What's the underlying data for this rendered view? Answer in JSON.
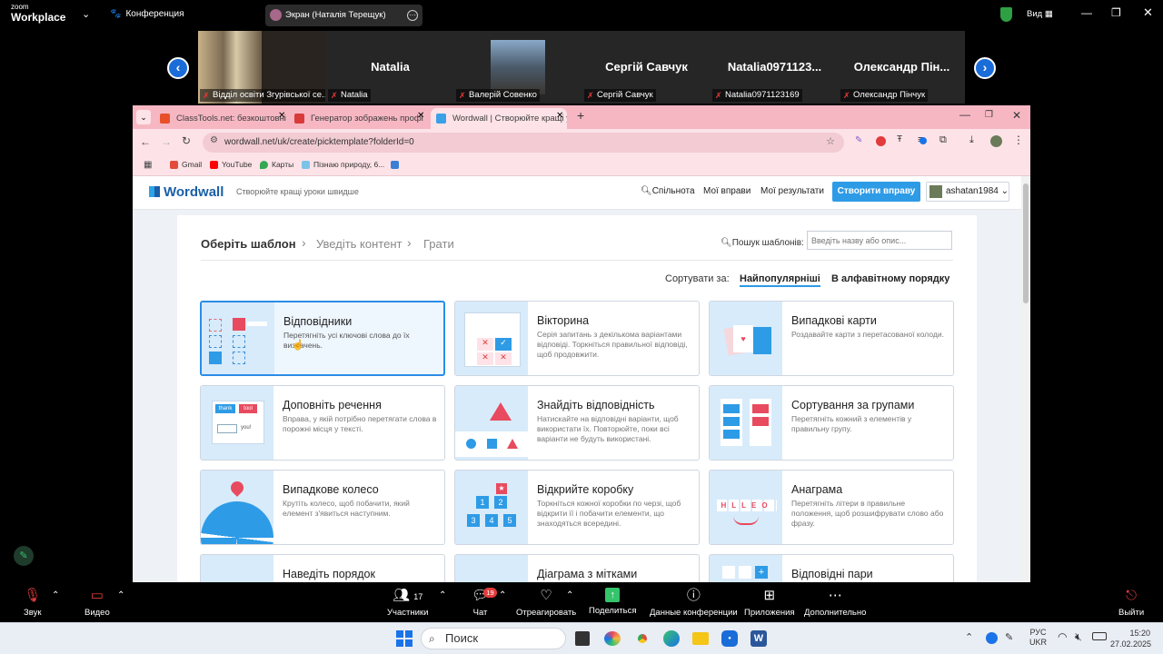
{
  "zoom": {
    "brand_top": "zoom",
    "brand_bottom": "Workplace",
    "meeting_title": "Конференция",
    "share_label": "Экран (Наталія Терещук)",
    "view_label": "Вид"
  },
  "participants": [
    {
      "name": "",
      "label": "Відділ освіти Згурівської се..."
    },
    {
      "name": "Natalia",
      "label": "Natalia"
    },
    {
      "name": "",
      "label": "Валерій Совенко"
    },
    {
      "name": "Сергій Савчук",
      "label": "Сергій Савчук"
    },
    {
      "name": "Natalia0971123...",
      "label": "Natalia0971123169"
    },
    {
      "name": "Олександр Пін...",
      "label": "Олександр Пінчук"
    }
  ],
  "browser": {
    "tabs": [
      {
        "title": "ClassTools.net: безкоштовні ін...",
        "color": "#e8502a"
      },
      {
        "title": "Генератор зображень профіл...",
        "color": "#d93a3a"
      },
      {
        "title": "Wordwall | Створюйте кращі у...",
        "color": "#3aa0e8"
      }
    ],
    "url": "wordwall.net/uk/create/picktemplate?folderId=0",
    "bookmarks": [
      {
        "label": "Gmail",
        "color": "#e24b3b"
      },
      {
        "label": "YouTube",
        "color": "#ff0000"
      },
      {
        "label": "Карты",
        "color": "#34a853"
      },
      {
        "label": "Пізнаю природу, 6...",
        "color": "#7cc3e8"
      },
      {
        "label": "",
        "color": "#3a7fd4"
      }
    ]
  },
  "wordwall": {
    "logo": "Wordwall",
    "tagline": "Створюйте кращі уроки швидше",
    "nav": {
      "community": "Спільнота",
      "my_activities": "Мої вправи",
      "my_results": "Мої результати",
      "create": "Створити вправу",
      "user": "ashatan1984"
    },
    "steps": [
      "Оберіть шаблон",
      "Уведіть контент",
      "Грати"
    ],
    "search_label": "Пошук шаблонів:",
    "search_placeholder": "Введіть назву або опис...",
    "sort_label": "Сортувати за:",
    "sort_popular": "Найпопулярніші",
    "sort_alpha": "В алфавітному порядку",
    "templates": [
      {
        "title": "Відповідники",
        "desc": "Перетягніть усі ключові слова до їх визначень."
      },
      {
        "title": "Вікторина",
        "desc": "Серія запитань з декількома варіантами відповіді. Торкніться правильної відповіді, щоб продовжити."
      },
      {
        "title": "Випадкові карти",
        "desc": "Роздавайте карти з перетасованої колоди."
      },
      {
        "title": "Доповніть речення",
        "desc": "Вправа, у якій потрібно перетягати слова в порожні місця у тексті."
      },
      {
        "title": "Знайдіть відповідність",
        "desc": "Натискайте на відповідні варіанти, щоб використати їх. Повторюйте, поки всі варіанти не будуть використані."
      },
      {
        "title": "Сортування за групами",
        "desc": "Перетягніть кожний з елементів у правильну групу."
      },
      {
        "title": "Випадкове колесо",
        "desc": "Крутіть колесо, щоб побачити, який елемент з'явиться наступним."
      },
      {
        "title": "Відкрийте коробку",
        "desc": "Торкніться кожної коробки по черзі, щоб відкрити її і побачити елементи, що знаходяться всередині."
      },
      {
        "title": "Анаграма",
        "desc": "Перетягніть літери в правильне положення, щоб розшифрувати слово або фразу."
      },
      {
        "title": "Наведіть порядок",
        "desc": ""
      },
      {
        "title": "Діаграма з мітками",
        "desc": ""
      },
      {
        "title": "Відповідні пари",
        "desc": ""
      }
    ],
    "thumb_words": {
      "thank": "thank",
      "tool": "tool",
      "you": "you!",
      "anagram": "HLLEO",
      "box_numbers": [
        "1",
        "2",
        "3",
        "4",
        "5"
      ]
    }
  },
  "zoom_bar": {
    "audio": "Звук",
    "video": "Видео",
    "participants": "Участники",
    "participants_count": "17",
    "chat": "Чат",
    "chat_badge": "19",
    "react": "Отреагировать",
    "share": "Поделиться",
    "info": "Данные конференции",
    "apps": "Приложения",
    "more": "Дополнительно",
    "leave": "Выйти"
  },
  "taskbar": {
    "search": "Поиск",
    "lang_top": "РУС",
    "lang_bottom": "UKR",
    "time": "15:20",
    "date": "27.02.2025"
  }
}
